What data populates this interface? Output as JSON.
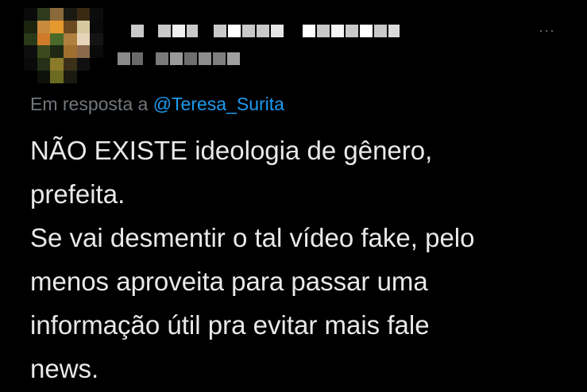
{
  "header": {
    "more_label": "···"
  },
  "reply": {
    "prefix": "Em resposta a",
    "mention": "@Teresa_Surita"
  },
  "tweet": {
    "lines": [
      "NÃO EXISTE ideologia de gênero,",
      "prefeita.",
      "Se vai desmentir o tal vídeo fake, pelo",
      "menos aproveita para passar uma",
      "informação útil pra evitar mais fale",
      "news."
    ]
  },
  "colors": {
    "background": "#000000",
    "text": "#e7e9ea",
    "muted": "#71767b",
    "link": "#1d9bf0"
  }
}
